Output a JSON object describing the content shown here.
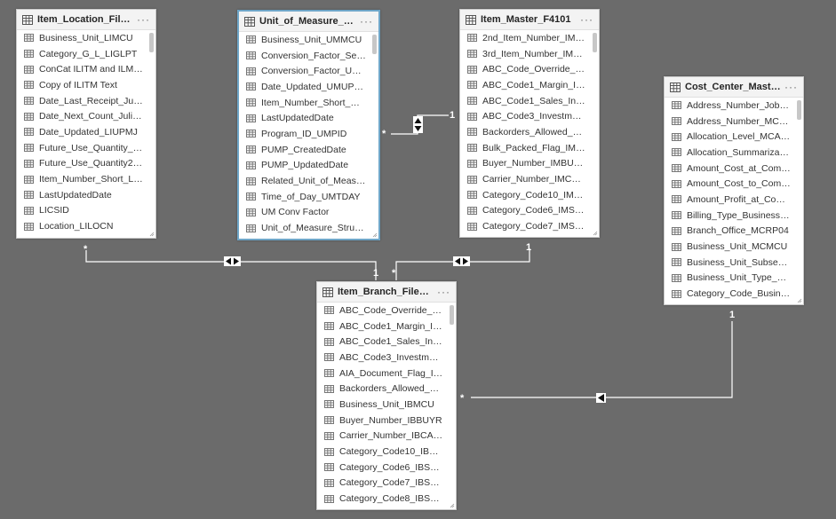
{
  "tables": [
    {
      "name": "Item_Location_File_F...",
      "more": "···",
      "columns": [
        "Business_Unit_LIMCU",
        "Category_G_L_LIGLPT",
        "ConCat ILITM and ILMCU",
        "Copy of ILITM Text",
        "Date_Last_Receipt_Julian_...",
        "Date_Next_Count_Julian_...",
        "Date_Updated_LIUPMJ",
        "Future_Use_Quantity_LIQ...",
        "Future_Use_Quantity2_Li...",
        "Item_Number_Short_LIITM",
        "LastUpdatedDate",
        "LICSID",
        "Location_LILOCN"
      ]
    },
    {
      "name": "Unit_of_Measure_Co...",
      "more": "···",
      "columns": [
        "Business_Unit_UMMCU",
        "Conversion_Factor_Secon...",
        "Conversion_Factor_UMC...",
        "Date_Updated_UMUPMJ",
        "Item_Number_Short_UMI...",
        "LastUpdatedDate",
        "Program_ID_UMPID",
        "PUMP_CreatedDate",
        "PUMP_UpdatedDate",
        "Related_Unit_of_Measure...",
        "Time_of_Day_UMTDAY",
        "UM Conv Factor",
        "Unit_of_Measure_Structur..."
      ]
    },
    {
      "name": "Item_Master_F4101",
      "more": "···",
      "columns": [
        "2nd_Item_Number_IMLITM",
        "3rd_Item_Number_IMAITM",
        "ABC_Code_Override_Indi...",
        "ABC_Code1_Margin_Inve...",
        "ABC_Code1_Sales_Invent...",
        "ABC_Code3_Investment_I...",
        "Backorders_Allowed_Yor...",
        "Bulk_Packed_Flag_IMBPFG",
        "Buyer_Number_IMBUYR",
        "Carrier_Number_IMCARS",
        "Category_Code10_IMSRP0",
        "Category_Code6_IMSRP6",
        "Category_Code7_IMSRP7"
      ]
    },
    {
      "name": "Cost_Center_Master_...",
      "more": "···",
      "columns": [
        "Address_Number_Job_A...",
        "Address_Number_MCAN8",
        "Allocation_Level_MCALCL",
        "Allocation_Summarizatio...",
        "Amount_Cost_at_Comple...",
        "Amount_Cost_to_Comple...",
        "Amount_Profit_at_Compl...",
        "Billing_Type_Business_Uni...",
        "Branch_Office_MCRP04",
        "Business_Unit_MCMCU",
        "Business_Unit_Subsequen...",
        "Business_Unit_Type_MCS...",
        "Category_Code_Business_..."
      ]
    },
    {
      "name": "Item_Branch_File_F4...",
      "more": "···",
      "columns": [
        "ABC_Code_Override_Indi...",
        "ABC_Code1_Margin_Inve...",
        "ABC_Code1_Sales_Invent...",
        "ABC_Code3_Investment_I...",
        "AIA_Document_Flag_IBFU...",
        "Backorders_Allowed_Y_N...",
        "Business_Unit_IBMCU",
        "Buyer_Number_IBBUYR",
        "Carrier_Number_IBCARS",
        "Category_Code10_IBSRP0",
        "Category_Code6_IBSRP6",
        "Category_Code7_IBSRP7",
        "Category_Code8_IBSRP8"
      ]
    }
  ],
  "cardinality": {
    "many": "*",
    "one": "1"
  },
  "colors": {
    "canvas": "#6b6b6b",
    "line": "#ffffff",
    "selected_border": "#6fa6c8"
  },
  "icons": {
    "table": "table-icon",
    "column": "column-icon",
    "more": "more-options-icon"
  }
}
